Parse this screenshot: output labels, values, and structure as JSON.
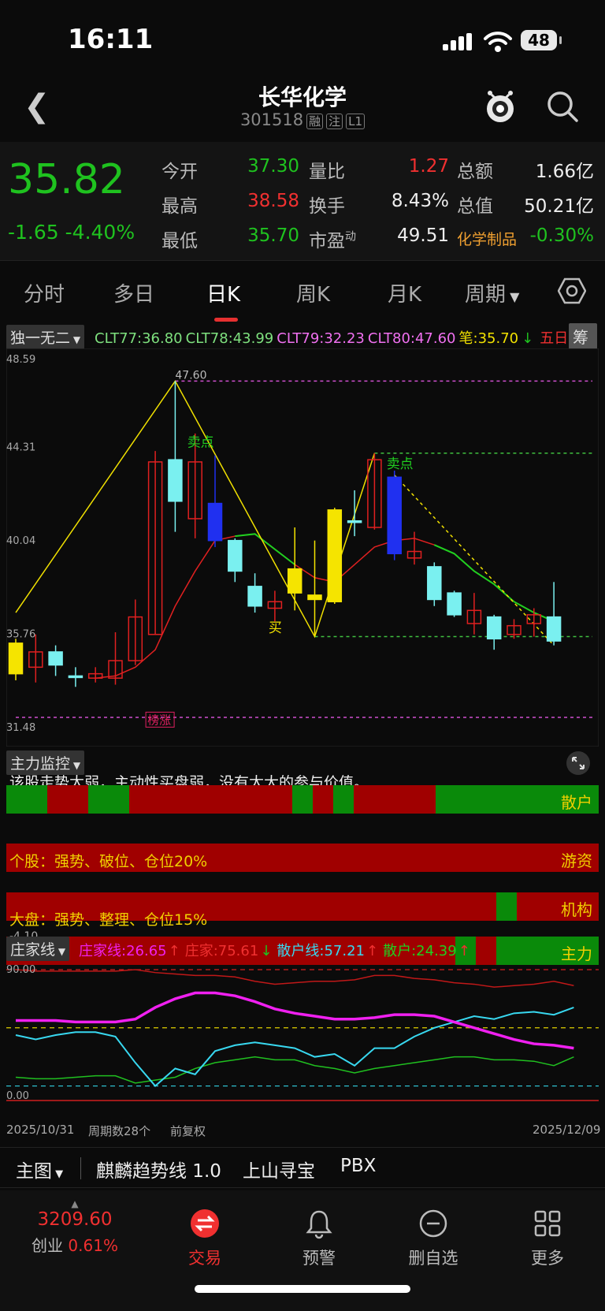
{
  "status": {
    "time": "16:11",
    "battery": "48"
  },
  "nav": {
    "title": "长华化学",
    "code": "301518",
    "tags": [
      "融",
      "注",
      "L1"
    ]
  },
  "quote": {
    "price": "35.82",
    "change": "-1.65",
    "change_pct": "-4.40%",
    "cells": [
      {
        "label": "今开",
        "value": "37.30",
        "color": "green"
      },
      {
        "label": "量比",
        "value": "1.27",
        "color": "red"
      },
      {
        "label": "总额",
        "value": "1.66亿",
        "color": "white"
      },
      {
        "label": "最高",
        "value": "38.58",
        "color": "red"
      },
      {
        "label": "换手",
        "value": "8.43%",
        "color": "white"
      },
      {
        "label": "总值",
        "value": "50.21亿",
        "color": "white"
      },
      {
        "label": "最低",
        "value": "35.70",
        "color": "green"
      },
      {
        "label": "市盈",
        "value": "49.51",
        "color": "white",
        "sup": "动"
      },
      {
        "label": "化学制品",
        "value": "-0.30%",
        "color": "green"
      }
    ]
  },
  "tabs": [
    "分时",
    "多日",
    "日K",
    "周K",
    "月K",
    "周期"
  ],
  "active_tab": "日K",
  "indicator": {
    "selector": "独一无二",
    "items": [
      {
        "text": "CLT77:36.80",
        "color": "#7ee07e"
      },
      {
        "text": "CLT78:43.99",
        "color": "#7ee07e"
      },
      {
        "text": "CLT79:32.23",
        "color": "#f070f0"
      },
      {
        "text": "CLT80:47.60",
        "color": "#f070f0"
      },
      {
        "text": "笔:35.70",
        "color": "#f0e000"
      },
      {
        "text": "↓",
        "color": "#1fc21f"
      },
      {
        "text": "五日",
        "color": "#f03030"
      }
    ],
    "chip_button": "筹"
  },
  "chart_data": {
    "type": "candlestick",
    "yticks": [
      "48.59",
      "44.31",
      "40.04",
      "35.76",
      "31.48"
    ],
    "ylim": [
      31.48,
      48.59
    ],
    "candles": [
      {
        "o": 34.2,
        "c": 35.6,
        "h": 35.8,
        "l": 33.9,
        "style": "yellow"
      },
      {
        "o": 34.5,
        "c": 35.2,
        "h": 36.0,
        "l": 33.8,
        "style": "red"
      },
      {
        "o": 35.2,
        "c": 34.6,
        "h": 35.5,
        "l": 34.1,
        "style": "cyan"
      },
      {
        "o": 34.1,
        "c": 34.1,
        "h": 34.5,
        "l": 33.6,
        "style": "cyan"
      },
      {
        "o": 34.0,
        "c": 34.2,
        "h": 34.5,
        "l": 33.8,
        "style": "red"
      },
      {
        "o": 34.0,
        "c": 34.8,
        "h": 36.1,
        "l": 33.7,
        "style": "red"
      },
      {
        "o": 34.8,
        "c": 36.8,
        "h": 37.6,
        "l": 34.6,
        "style": "red"
      },
      {
        "o": 36.0,
        "c": 43.9,
        "h": 44.4,
        "l": 36.0,
        "style": "red"
      },
      {
        "o": 44.0,
        "c": 42.1,
        "h": 47.6,
        "l": 40.7,
        "style": "cyan"
      },
      {
        "o": 41.3,
        "c": 43.9,
        "h": 45.2,
        "l": 40.4,
        "style": "red"
      },
      {
        "o": 42.0,
        "c": 40.3,
        "h": 44.2,
        "l": 40.0,
        "style": "blue"
      },
      {
        "o": 40.3,
        "c": 38.9,
        "h": 40.4,
        "l": 38.4,
        "style": "cyan"
      },
      {
        "o": 38.2,
        "c": 37.3,
        "h": 38.8,
        "l": 37.0,
        "style": "cyan"
      },
      {
        "o": 37.2,
        "c": 37.5,
        "h": 38.0,
        "l": 36.6,
        "style": "red"
      },
      {
        "o": 37.9,
        "c": 39.0,
        "h": 40.9,
        "l": 37.1,
        "style": "yellow"
      },
      {
        "o": 37.6,
        "c": 37.8,
        "h": 40.3,
        "l": 35.9,
        "style": "yellow"
      },
      {
        "o": 37.5,
        "c": 41.7,
        "h": 41.8,
        "l": 37.4,
        "style": "yellow"
      },
      {
        "o": 41.2,
        "c": 41.2,
        "h": 42.6,
        "l": 40.5,
        "style": "cyan"
      },
      {
        "o": 40.9,
        "c": 44.0,
        "h": 44.3,
        "l": 40.8,
        "style": "red"
      },
      {
        "o": 43.2,
        "c": 39.7,
        "h": 43.5,
        "l": 39.4,
        "style": "blue"
      },
      {
        "o": 39.8,
        "c": 39.5,
        "h": 40.7,
        "l": 39.2,
        "style": "red"
      },
      {
        "o": 39.1,
        "c": 37.6,
        "h": 39.3,
        "l": 37.3,
        "style": "cyan"
      },
      {
        "o": 37.9,
        "c": 36.9,
        "h": 38.0,
        "l": 36.8,
        "style": "cyan"
      },
      {
        "o": 37.1,
        "c": 36.5,
        "h": 37.9,
        "l": 36.0,
        "style": "red"
      },
      {
        "o": 36.8,
        "c": 35.8,
        "h": 36.9,
        "l": 35.3,
        "style": "cyan"
      },
      {
        "o": 36.4,
        "c": 36.0,
        "h": 36.7,
        "l": 35.8,
        "style": "red"
      },
      {
        "o": 36.9,
        "c": 36.5,
        "h": 37.2,
        "l": 35.9,
        "style": "red"
      },
      {
        "o": 35.7,
        "c": 36.8,
        "h": 38.4,
        "l": 35.5,
        "style": "cyan"
      }
    ],
    "ma": [
      null,
      null,
      null,
      null,
      34.0,
      34.1,
      34.5,
      35.3,
      37.3,
      38.9,
      40.3,
      40.5,
      40.6,
      39.9,
      39.2,
      38.6,
      38.4,
      39.2,
      40.0,
      40.3,
      40.4,
      40.1,
      39.7,
      38.9,
      38.3,
      37.5,
      37.0,
      36.6
    ],
    "zigzag": [
      {
        "i": 0,
        "v": 37.0
      },
      {
        "i": 8,
        "v": 47.6
      },
      {
        "i": 15,
        "v": 35.9
      },
      {
        "i": 18,
        "v": 44.3
      }
    ],
    "sell_trend": [
      {
        "i": 19,
        "v": 43.3
      },
      {
        "i": 27,
        "v": 35.5
      }
    ],
    "hlines": [
      {
        "v": 47.6,
        "from": 8
      },
      {
        "v": 44.3,
        "from": 18
      },
      {
        "v": 35.9,
        "from": 15
      },
      {
        "v": 32.2,
        "from": 0
      }
    ],
    "annotations": [
      {
        "text": "47.60",
        "i": 8,
        "v": 47.7
      },
      {
        "text": "卖点",
        "i": 9,
        "v": 44.6
      },
      {
        "text": "买",
        "i": 13,
        "v": 36.1
      },
      {
        "text": "卖点",
        "i": 19,
        "v": 43.6
      },
      {
        "text": "榜涨",
        "i": 7,
        "v": 31.9
      }
    ]
  },
  "monitor": {
    "selector": "主力监控",
    "note": "该股走势太弱，主动性买盘弱，没有太大的参与价值。",
    "individual": "个股：强势、破位、仓位20%",
    "market": "大盘：强势、整理、仓位15%",
    "low_tick": "-4.10",
    "bands": [
      {
        "label": "散户",
        "segments": [
          [
            "g",
            2
          ],
          [
            "r",
            2
          ],
          [
            "g",
            2
          ],
          [
            "r",
            8
          ],
          [
            "g",
            1
          ],
          [
            "r",
            1
          ],
          [
            "g",
            1
          ],
          [
            "r",
            4
          ],
          [
            "g",
            8
          ]
        ]
      },
      {
        "label": "游资",
        "segments": [
          [
            "r",
            29
          ]
        ]
      },
      {
        "label": "机构",
        "segments": [
          [
            "r",
            24
          ],
          [
            "g",
            1
          ],
          [
            "r",
            4
          ]
        ]
      },
      {
        "label": "主力",
        "segments": [
          [
            "r",
            22
          ],
          [
            "g",
            1
          ],
          [
            "r",
            1
          ],
          [
            "g",
            5
          ]
        ]
      }
    ]
  },
  "zhuang": {
    "selector": "庄家线",
    "items": [
      {
        "text": "庄家线:26.65",
        "color": "#f020f0"
      },
      {
        "text": "↑",
        "color": "#f03030"
      },
      {
        "text": "庄家:75.61",
        "color": "#f03030"
      },
      {
        "text": "↓",
        "color": "#1fc21f"
      },
      {
        "text": "散户线:57.21",
        "color": "#38d8f0"
      },
      {
        "text": "↑",
        "color": "#f03030"
      },
      {
        "text": "散户:24.39",
        "color": "#1fd01f"
      },
      {
        "text": "↑",
        "color": "#f03030"
      }
    ],
    "ymax": "90.00",
    "ymin": "0.00",
    "zj_line": [
      55,
      55,
      55,
      54,
      54,
      54,
      56,
      64,
      70,
      74,
      74,
      72,
      68,
      63,
      60,
      58,
      56,
      56,
      57,
      59,
      59,
      58,
      54,
      50,
      46,
      42,
      39,
      38,
      36
    ],
    "zhuang": [
      90,
      89,
      89,
      89,
      89,
      89,
      90,
      88,
      87,
      86,
      86,
      85,
      82,
      80,
      81,
      82,
      82,
      83,
      86,
      86,
      84,
      83,
      81,
      80,
      78,
      79,
      80,
      82,
      79
    ],
    "sanhu_line": [
      45,
      42,
      45,
      47,
      47,
      44,
      26,
      10,
      22,
      18,
      34,
      38,
      40,
      38,
      36,
      30,
      32,
      24,
      36,
      36,
      44,
      50,
      54,
      58,
      56,
      60,
      61,
      59,
      64
    ],
    "sanhu": [
      16,
      15,
      15,
      16,
      17,
      17,
      12,
      14,
      16,
      22,
      26,
      28,
      30,
      28,
      28,
      24,
      22,
      19,
      22,
      24,
      26,
      28,
      30,
      30,
      28,
      28,
      27,
      24,
      30
    ]
  },
  "dates": {
    "start": "2025/10/31",
    "periods": "周期数28个",
    "adjust": "前复权",
    "end": "2025/12/09"
  },
  "subtabs": [
    "主图",
    "麒麟趋势线 1.0",
    "上山寻宝",
    "PBX"
  ],
  "bottom": {
    "index_value": "3209.60",
    "index_name": "创业",
    "index_change": "0.61%",
    "items": [
      "交易",
      "预警",
      "删自选",
      "更多"
    ]
  }
}
